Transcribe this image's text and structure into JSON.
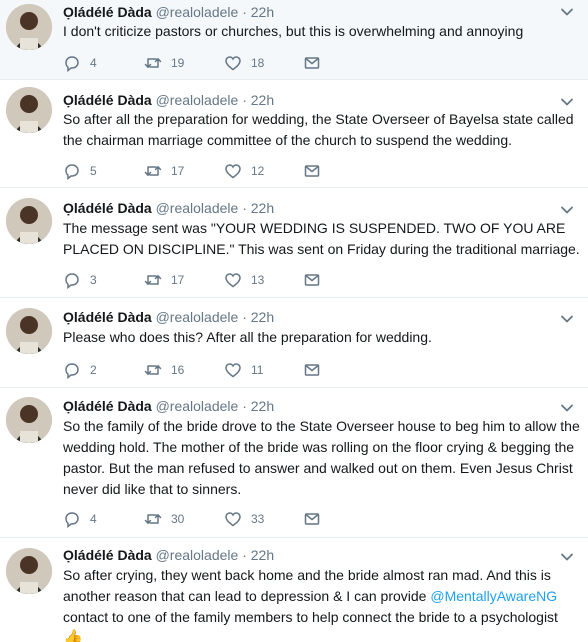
{
  "author": {
    "name": "Ọládélé Dàda",
    "handle": "@realoladele",
    "separator": "·"
  },
  "tweets": [
    {
      "time": "22h",
      "text": "I don't criticize pastors or churches, but this is overwhelming and annoying",
      "replies": "4",
      "retweets": "19",
      "likes": "18"
    },
    {
      "time": "22h",
      "text": "So after all the preparation for wedding, the State Overseer of Bayelsa state called the chairman marriage committee of the church to suspend the wedding.",
      "replies": "5",
      "retweets": "17",
      "likes": "12"
    },
    {
      "time": "22h",
      "text": "The message sent was \"YOUR WEDDING IS SUSPENDED. TWO OF YOU ARE PLACED ON DISCIPLINE.\" This was sent on Friday during the traditional marriage.",
      "replies": "3",
      "retweets": "17",
      "likes": "13"
    },
    {
      "time": "22h",
      "text": "Please who does this? After all the preparation for wedding.",
      "replies": "2",
      "retweets": "16",
      "likes": "11"
    },
    {
      "time": "22h",
      "text": "So the family of the bride drove to the State Overseer house to beg him to allow the wedding hold. The mother of the bride was rolling on the floor crying & begging the pastor. But the man refused to answer and walked out on them. Even Jesus Christ never did like that to sinners.",
      "replies": "4",
      "retweets": "30",
      "likes": "33"
    },
    {
      "time": "22h",
      "text_before": "So after crying, they went back home and the bride almost ran mad. And this is another reason that can lead to depression & I can provide ",
      "mention": "@MentallyAwareNG",
      "text_after": " contact to one of the family members to help connect the bride to a psychologist",
      "emoji": "👍"
    }
  ],
  "colors": {
    "accent": "#1da1f2",
    "secondary_text": "#657786",
    "highlight_bg": "#f5f8fa",
    "divider": "#e6ecf0"
  },
  "icons": [
    "chevron-down-icon",
    "reply-icon",
    "retweet-icon",
    "like-icon",
    "direct-message-icon"
  ]
}
